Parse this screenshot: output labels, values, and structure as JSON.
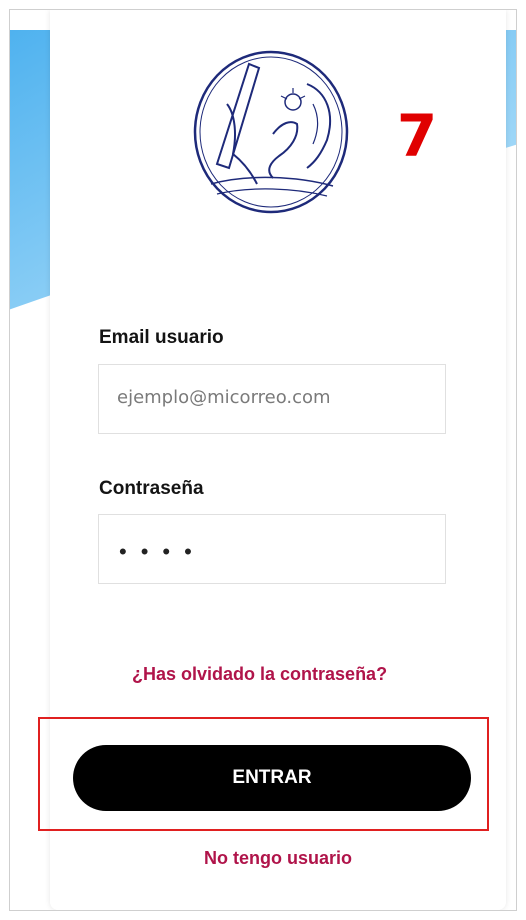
{
  "form": {
    "email_label": "Email usuario",
    "email_placeholder": "ejemplo@micorreo.com",
    "password_label": "Contraseña",
    "password_value": "••••",
    "forgot_link": "¿Has olvidado la contraseña?",
    "submit_label": "ENTRAR",
    "signup_link": "No tengo usuario"
  },
  "badge": {
    "text": "7"
  },
  "colors": {
    "accent": "#b0144a",
    "button": "#000000",
    "highlight": "#e02020",
    "wave": "#5ab8f0"
  }
}
